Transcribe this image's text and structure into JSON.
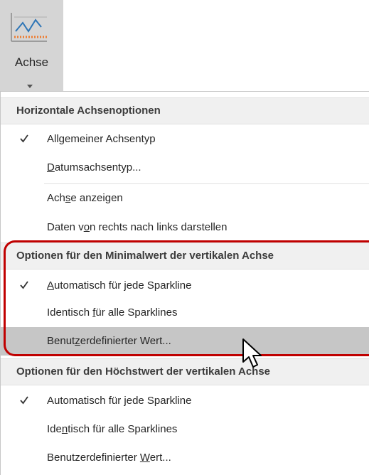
{
  "ribbon": {
    "button_label": "Achse",
    "icon": "axis-chart-icon"
  },
  "menu": {
    "section_horizontal": {
      "title": "Horizontale Achsenoptionen",
      "items": [
        {
          "pre": "All",
          "ul": "g",
          "post": "emeiner Achsentyp",
          "checked": true
        },
        {
          "pre": "",
          "ul": "D",
          "post": "atumsachsentyp...",
          "checked": false
        },
        {
          "pre": "Ach",
          "ul": "s",
          "post": "e anzeigen",
          "checked": false
        },
        {
          "pre": "Daten v",
          "ul": "o",
          "post": "n rechts nach links darstellen",
          "checked": false
        }
      ]
    },
    "section_min": {
      "title": "Optionen für den Minimalwert der vertikalen Achse",
      "items": [
        {
          "pre": "",
          "ul": "A",
          "post": "utomatisch für jede Sparkline",
          "checked": true
        },
        {
          "pre": "Identisch ",
          "ul": "f",
          "post": "ür alle Sparklines",
          "checked": false
        },
        {
          "pre": "Benut",
          "ul": "z",
          "post": "erdefinierter Wert...",
          "checked": false
        }
      ]
    },
    "section_max": {
      "title": "Optionen für den Höchstwert der vertikalen Achse",
      "items": [
        {
          "pre": "Automatisch für ",
          "ul": "j",
          "post": "ede Sparkline",
          "checked": true
        },
        {
          "pre": "Ide",
          "ul": "n",
          "post": "tisch für alle Sparklines",
          "checked": false
        },
        {
          "pre": "Benutzerdefinierter ",
          "ul": "W",
          "post": "ert...",
          "checked": false
        }
      ]
    }
  },
  "colors": {
    "highlight_border": "#c00000",
    "hover_bg": "#c6c6c6",
    "ribbon_active_bg": "#d5d5d5",
    "icon_blue": "#2e75b6",
    "icon_orange": "#ed7d31"
  }
}
